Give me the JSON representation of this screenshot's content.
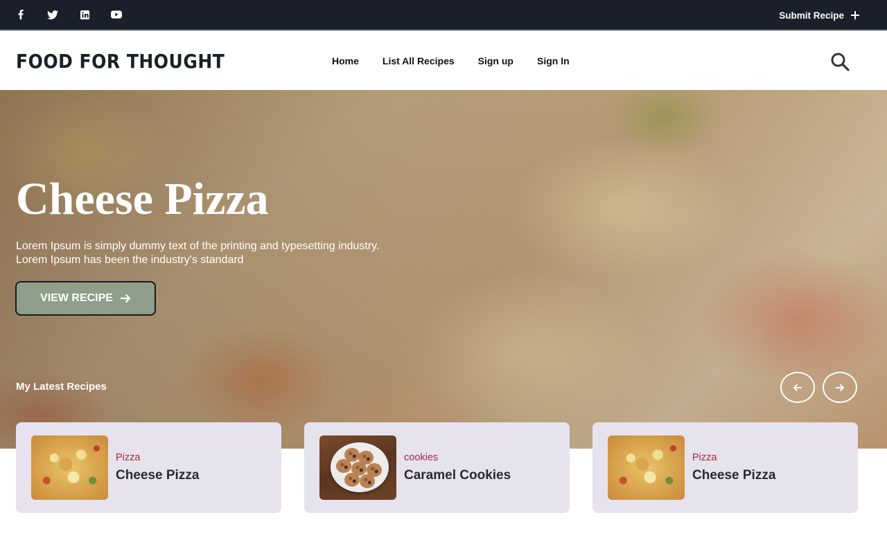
{
  "topbar": {
    "social_icons": [
      "facebook-icon",
      "twitter-icon",
      "linkedin-icon",
      "youtube-icon"
    ],
    "submit_label": "Submit Recipe"
  },
  "header": {
    "logo": "FOOD FOR THOUGHT",
    "nav": [
      "Home",
      "List All Recipes",
      "Sign up",
      "Sign In"
    ],
    "search_icon": "search-icon"
  },
  "hero": {
    "title": "Cheese Pizza",
    "description": "Lorem Ipsum is simply dummy text of the printing and typesetting industry. Lorem Ipsum has been the industry's standard",
    "button_label": "VIEW RECIPE",
    "latest_label": "My Latest Recipes"
  },
  "cards": [
    {
      "category": "Pizza",
      "title": "Cheese Pizza",
      "image": "pizza"
    },
    {
      "category": "cookies",
      "title": "Caramel Cookies",
      "image": "cookies"
    },
    {
      "category": "Pizza",
      "title": "Cheese Pizza",
      "image": "pizza"
    }
  ],
  "colors": {
    "topbar_bg": "#1b1f29",
    "button_bg": "#8e9e88",
    "card_bg": "#e6e3ee",
    "category_text": "#a52a3a"
  }
}
